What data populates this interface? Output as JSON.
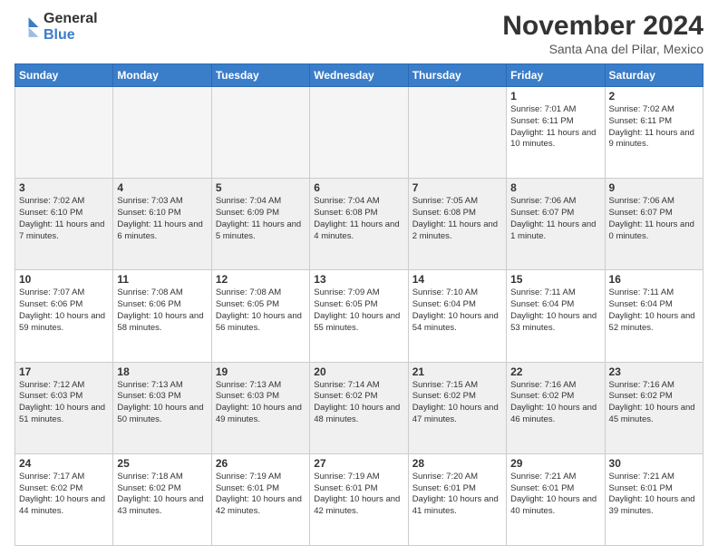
{
  "logo": {
    "general": "General",
    "blue": "Blue"
  },
  "header": {
    "month": "November 2024",
    "location": "Santa Ana del Pilar, Mexico"
  },
  "weekdays": [
    "Sunday",
    "Monday",
    "Tuesday",
    "Wednesday",
    "Thursday",
    "Friday",
    "Saturday"
  ],
  "weeks": [
    [
      {
        "day": "",
        "empty": true
      },
      {
        "day": "",
        "empty": true
      },
      {
        "day": "",
        "empty": true
      },
      {
        "day": "",
        "empty": true
      },
      {
        "day": "",
        "empty": true
      },
      {
        "day": "1",
        "sunrise": "7:01 AM",
        "sunset": "6:11 PM",
        "daylight": "11 hours and 10 minutes."
      },
      {
        "day": "2",
        "sunrise": "7:02 AM",
        "sunset": "6:11 PM",
        "daylight": "11 hours and 9 minutes."
      }
    ],
    [
      {
        "day": "3",
        "sunrise": "7:02 AM",
        "sunset": "6:10 PM",
        "daylight": "11 hours and 7 minutes."
      },
      {
        "day": "4",
        "sunrise": "7:03 AM",
        "sunset": "6:10 PM",
        "daylight": "11 hours and 6 minutes."
      },
      {
        "day": "5",
        "sunrise": "7:04 AM",
        "sunset": "6:09 PM",
        "daylight": "11 hours and 5 minutes."
      },
      {
        "day": "6",
        "sunrise": "7:04 AM",
        "sunset": "6:08 PM",
        "daylight": "11 hours and 4 minutes."
      },
      {
        "day": "7",
        "sunrise": "7:05 AM",
        "sunset": "6:08 PM",
        "daylight": "11 hours and 2 minutes."
      },
      {
        "day": "8",
        "sunrise": "7:06 AM",
        "sunset": "6:07 PM",
        "daylight": "11 hours and 1 minute."
      },
      {
        "day": "9",
        "sunrise": "7:06 AM",
        "sunset": "6:07 PM",
        "daylight": "11 hours and 0 minutes."
      }
    ],
    [
      {
        "day": "10",
        "sunrise": "7:07 AM",
        "sunset": "6:06 PM",
        "daylight": "10 hours and 59 minutes."
      },
      {
        "day": "11",
        "sunrise": "7:08 AM",
        "sunset": "6:06 PM",
        "daylight": "10 hours and 58 minutes."
      },
      {
        "day": "12",
        "sunrise": "7:08 AM",
        "sunset": "6:05 PM",
        "daylight": "10 hours and 56 minutes."
      },
      {
        "day": "13",
        "sunrise": "7:09 AM",
        "sunset": "6:05 PM",
        "daylight": "10 hours and 55 minutes."
      },
      {
        "day": "14",
        "sunrise": "7:10 AM",
        "sunset": "6:04 PM",
        "daylight": "10 hours and 54 minutes."
      },
      {
        "day": "15",
        "sunrise": "7:11 AM",
        "sunset": "6:04 PM",
        "daylight": "10 hours and 53 minutes."
      },
      {
        "day": "16",
        "sunrise": "7:11 AM",
        "sunset": "6:04 PM",
        "daylight": "10 hours and 52 minutes."
      }
    ],
    [
      {
        "day": "17",
        "sunrise": "7:12 AM",
        "sunset": "6:03 PM",
        "daylight": "10 hours and 51 minutes."
      },
      {
        "day": "18",
        "sunrise": "7:13 AM",
        "sunset": "6:03 PM",
        "daylight": "10 hours and 50 minutes."
      },
      {
        "day": "19",
        "sunrise": "7:13 AM",
        "sunset": "6:03 PM",
        "daylight": "10 hours and 49 minutes."
      },
      {
        "day": "20",
        "sunrise": "7:14 AM",
        "sunset": "6:02 PM",
        "daylight": "10 hours and 48 minutes."
      },
      {
        "day": "21",
        "sunrise": "7:15 AM",
        "sunset": "6:02 PM",
        "daylight": "10 hours and 47 minutes."
      },
      {
        "day": "22",
        "sunrise": "7:16 AM",
        "sunset": "6:02 PM",
        "daylight": "10 hours and 46 minutes."
      },
      {
        "day": "23",
        "sunrise": "7:16 AM",
        "sunset": "6:02 PM",
        "daylight": "10 hours and 45 minutes."
      }
    ],
    [
      {
        "day": "24",
        "sunrise": "7:17 AM",
        "sunset": "6:02 PM",
        "daylight": "10 hours and 44 minutes."
      },
      {
        "day": "25",
        "sunrise": "7:18 AM",
        "sunset": "6:02 PM",
        "daylight": "10 hours and 43 minutes."
      },
      {
        "day": "26",
        "sunrise": "7:19 AM",
        "sunset": "6:01 PM",
        "daylight": "10 hours and 42 minutes."
      },
      {
        "day": "27",
        "sunrise": "7:19 AM",
        "sunset": "6:01 PM",
        "daylight": "10 hours and 42 minutes."
      },
      {
        "day": "28",
        "sunrise": "7:20 AM",
        "sunset": "6:01 PM",
        "daylight": "10 hours and 41 minutes."
      },
      {
        "day": "29",
        "sunrise": "7:21 AM",
        "sunset": "6:01 PM",
        "daylight": "10 hours and 40 minutes."
      },
      {
        "day": "30",
        "sunrise": "7:21 AM",
        "sunset": "6:01 PM",
        "daylight": "10 hours and 39 minutes."
      }
    ]
  ]
}
